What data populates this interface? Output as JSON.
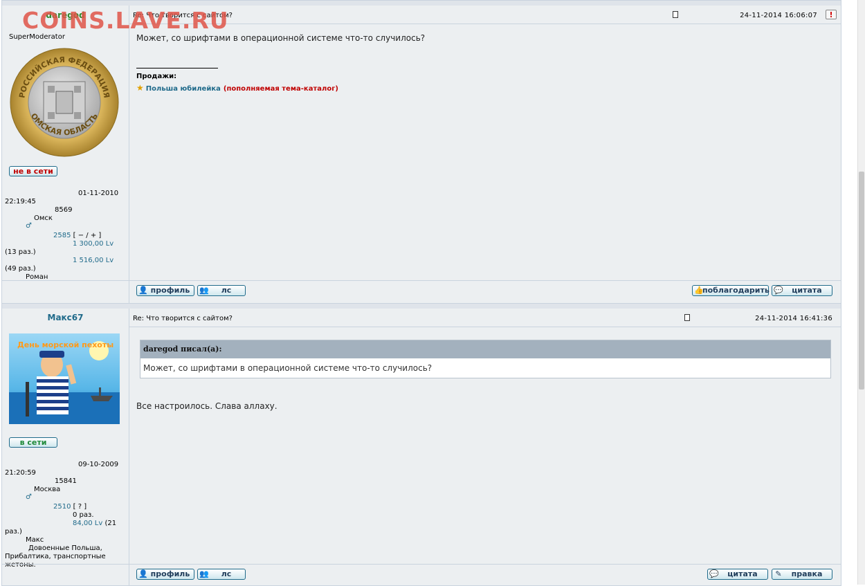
{
  "watermark": "COINS.LAVE.RU",
  "posts": [
    {
      "author": "daregod",
      "rank": "SuperModerator",
      "status": "не в сети",
      "reg_date": "01-11-2010",
      "reg_time": "22:19:45",
      "post_count": "8569",
      "city": "Омск",
      "rep": "2585",
      "rep_controls": "[ − / + ]",
      "thanks_given": "1 300,00 Lv",
      "thanks_given_times": "(13 раз.)",
      "thanks_received": "1 516,00 Lv",
      "thanks_received_times": "(49 раз.)",
      "real_name": "Роман",
      "subject": "Re: Что творится с сайтом?",
      "datetime": "24-11-2014 16:06:07",
      "report_icon": "!",
      "text": "Может, со шрифтами в операционной системе что-то случилось?",
      "sig_title": "Продажи:",
      "sig_link": "Польша юбилейка",
      "sig_note": "(пополняемая тема-каталог)",
      "buttons_left": [
        "профиль",
        "лс"
      ],
      "buttons_right": [
        "поблагодарить",
        "цитата"
      ]
    },
    {
      "author": "Макс67",
      "status": "в сети",
      "reg_date": "09-10-2009",
      "reg_time": "21:20:59",
      "post_count": "15841",
      "city": "Москва",
      "rep": "2510",
      "rep_controls": "[ ? ]",
      "thanks_given_times": "0 раз.",
      "thanks_received": "84,00 Lv",
      "thanks_received_times_a": "(21",
      "thanks_received_times_b": "раз.)",
      "real_name": "Макс",
      "interests_a": "Довоенные Польша,",
      "interests_b": "Прибалтика, транспортные",
      "interests_c": "жетоны.",
      "subject": "Re: Что творится с сайтом?",
      "datetime": "24-11-2014 16:41:36",
      "quote_author": "daregod писал(а):",
      "quote_text": "Может, со шрифтами в операционной системе что-то случилось?",
      "text": "Все настроилось. Слава аллаху.",
      "buttons_left": [
        "профиль",
        "лс"
      ],
      "buttons_right": [
        "цитата",
        "правка"
      ]
    }
  ],
  "avatar_coin_text_top": "РОССИЙСКАЯ ФЕДЕРАЦИЯ",
  "avatar_coin_text_bottom": "ОМСКАЯ ОБЛАСТЬ",
  "avatar2_caption": "День морской пехоты",
  "colors": {
    "link": "#1f6a8a",
    "sig_note": "#c00000",
    "quote_header": "#a3b1be"
  }
}
